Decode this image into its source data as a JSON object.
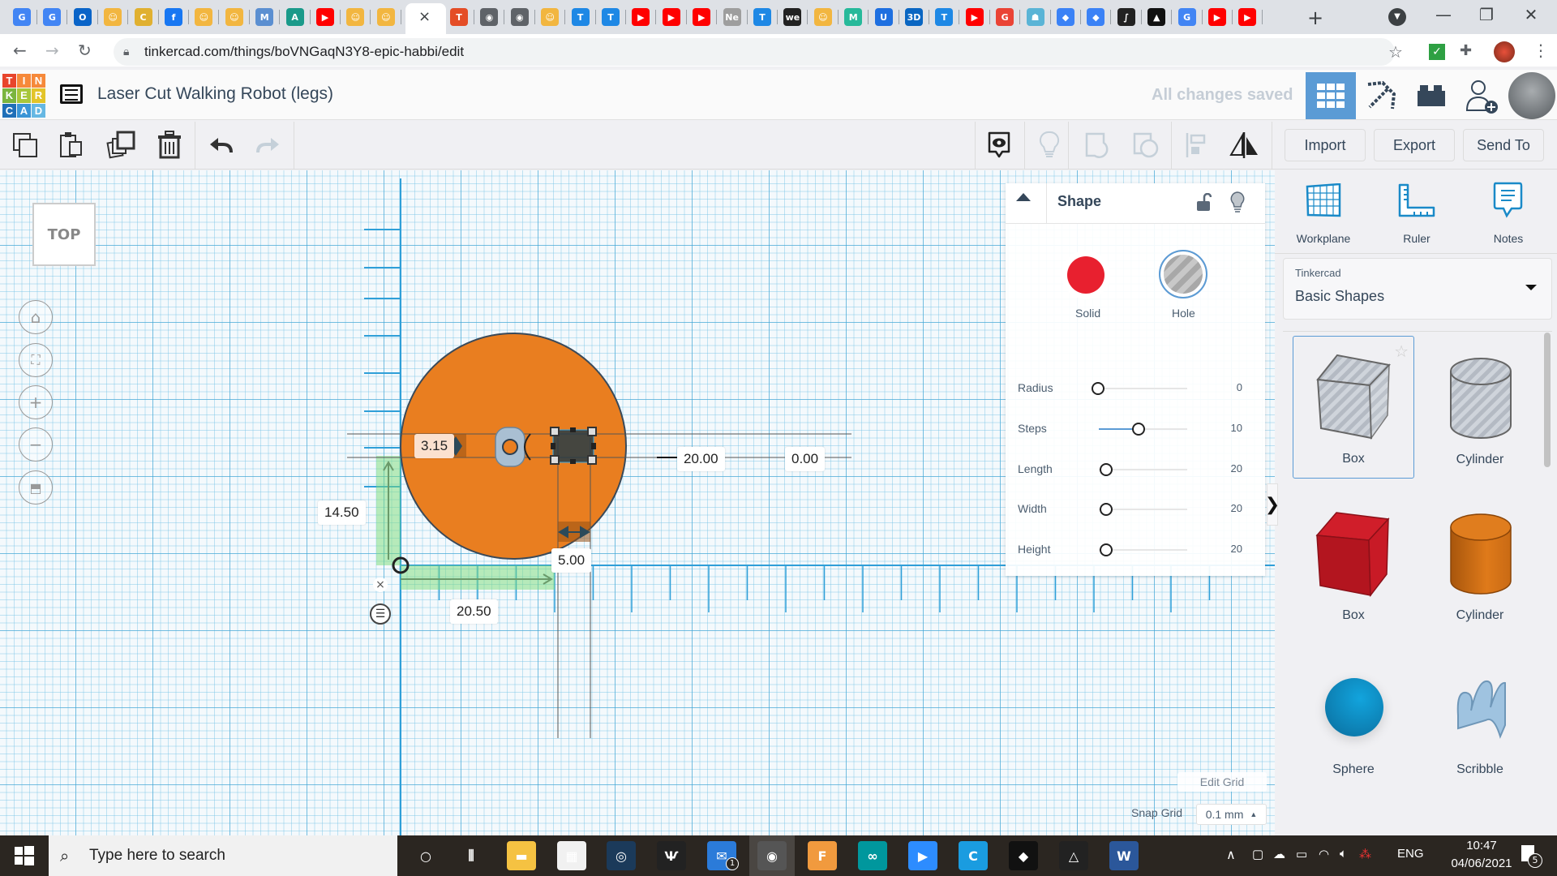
{
  "browser": {
    "url": "tinkercad.com/things/boVNGaqN3Y8-epic-habbi/edit",
    "active_tab_close": "×",
    "new_tab": "+",
    "tabs": [
      {
        "icon": "google-translate",
        "text": "G",
        "color": "#4285f4"
      },
      {
        "icon": "google-translate",
        "text": "G",
        "color": "#4285f4"
      },
      {
        "icon": "outlook",
        "text": "O",
        "color": "#0a64c8"
      },
      {
        "icon": "robot-avatar",
        "text": "☺",
        "color": "#f2b640"
      },
      {
        "icon": "c-logo",
        "text": "C",
        "color": "#e0b030"
      },
      {
        "icon": "facebook",
        "text": "f",
        "color": "#1877f2"
      },
      {
        "icon": "robot-avatar",
        "text": "☺",
        "color": "#f2b640"
      },
      {
        "icon": "robot-avatar",
        "text": "☺",
        "color": "#f2b640"
      },
      {
        "icon": "hex-m",
        "text": "M",
        "color": "#5b8fd1"
      },
      {
        "icon": "autodesk",
        "text": "A",
        "color": "#1a9a8a"
      },
      {
        "icon": "youtube",
        "text": "▶",
        "color": "#ff0000"
      },
      {
        "icon": "robot-avatar",
        "text": "☺",
        "color": "#f2b640"
      },
      {
        "icon": "robot-avatar",
        "text": "☺",
        "color": "#f2b640"
      }
    ],
    "tabs_after": [
      {
        "icon": "tinkercad",
        "text": "T",
        "color": "#e44d26"
      },
      {
        "icon": "globe",
        "text": "◉",
        "color": "#5f6368"
      },
      {
        "icon": "globe",
        "text": "◉",
        "color": "#5f6368"
      },
      {
        "icon": "robot-avatar",
        "text": "☺",
        "color": "#f2b640"
      },
      {
        "icon": "instructables",
        "text": "T",
        "color": "#1e88e5"
      },
      {
        "icon": "instructables",
        "text": "T",
        "color": "#1e88e5"
      },
      {
        "icon": "youtube",
        "text": "▶",
        "color": "#ff0000"
      },
      {
        "icon": "youtube",
        "text": "▶",
        "color": "#ff0000"
      },
      {
        "icon": "youtube",
        "text": "▶",
        "color": "#ff0000"
      },
      {
        "icon": "ne",
        "text": "Ne",
        "color": "#9e9e9e"
      },
      {
        "icon": "instructables",
        "text": "T",
        "color": "#1e88e5"
      },
      {
        "icon": "we",
        "text": "we",
        "color": "#222222"
      },
      {
        "icon": "robot-avatar",
        "text": "☺",
        "color": "#f2b640"
      },
      {
        "icon": "m-logo",
        "text": "M",
        "color": "#26b99a"
      },
      {
        "icon": "u-logo",
        "text": "U",
        "color": "#1e6fe0"
      },
      {
        "icon": "3d-logo",
        "text": "3D",
        "color": "#0a66c2"
      },
      {
        "icon": "instructables",
        "text": "T",
        "color": "#1e88e5"
      },
      {
        "icon": "youtube",
        "text": "▶",
        "color": "#ff0000"
      },
      {
        "icon": "google",
        "text": "G",
        "color": "#ea4335"
      },
      {
        "icon": "robot",
        "text": "☗",
        "color": "#5ab4d6"
      },
      {
        "icon": "book",
        "text": "◆",
        "color": "#3b82f6"
      },
      {
        "icon": "book",
        "text": "◆",
        "color": "#3b82f6"
      },
      {
        "icon": "integral",
        "text": "∫",
        "color": "#222222"
      },
      {
        "icon": "inkscape",
        "text": "▲",
        "color": "#111111"
      },
      {
        "icon": "google",
        "text": "G",
        "color": "#4285f4"
      },
      {
        "icon": "youtube",
        "text": "▶",
        "color": "#ff0000"
      },
      {
        "icon": "youtube",
        "text": "▶",
        "color": "#ff0000"
      }
    ]
  },
  "header": {
    "logo_letters": [
      "T",
      "I",
      "N",
      "K",
      "E",
      "R",
      "C",
      "A",
      "D"
    ],
    "logo_colors": [
      "#e8452c",
      "#f6893a",
      "#f6893a",
      "#7bb53f",
      "#a8c63a",
      "#e3c429",
      "#1f6fb8",
      "#3a95d6",
      "#66b8e3"
    ],
    "title": "Laser Cut Walking Robot (legs)",
    "save_status": "All changes saved",
    "accent": "#5b9bd5"
  },
  "toolbar": {
    "import": "Import",
    "export": "Export",
    "send_to": "Send To"
  },
  "viewport": {
    "view_cube_label": "TOP",
    "dimensions": {
      "gap": "3.15",
      "length": "20.00",
      "elevation": "0.00",
      "y_offset": "14.50",
      "x_offset": "20.50",
      "width": "5.00"
    },
    "shape_color": "#e97e20"
  },
  "inspector": {
    "title": "Shape",
    "solid_label": "Solid",
    "hole_label": "Hole",
    "solid_color": "#e8202f",
    "params": [
      {
        "label": "Radius",
        "value": "0",
        "fraction": 0.0
      },
      {
        "label": "Steps",
        "value": "10",
        "fraction": 0.45
      },
      {
        "label": "Length",
        "value": "20",
        "fraction": 0.0
      },
      {
        "label": "Width",
        "value": "20",
        "fraction": 0.0
      },
      {
        "label": "Height",
        "value": "20",
        "fraction": 0.0
      }
    ]
  },
  "right_panel": {
    "tools": [
      "Workplane",
      "Ruler",
      "Notes"
    ],
    "library_provider": "Tinkercad",
    "library_name": "Basic Shapes",
    "shapes": [
      "Box",
      "Cylinder",
      "Box",
      "Cylinder",
      "Sphere",
      "Scribble"
    ]
  },
  "grid": {
    "edit_grid": "Edit Grid",
    "snap_label": "Snap Grid",
    "snap_value": "0.1 mm"
  },
  "taskbar": {
    "search_placeholder": "Type here to search",
    "language": "ENG",
    "time": "10:47",
    "date": "04/06/2021",
    "mail_badge": "1",
    "notification_count": "5"
  }
}
